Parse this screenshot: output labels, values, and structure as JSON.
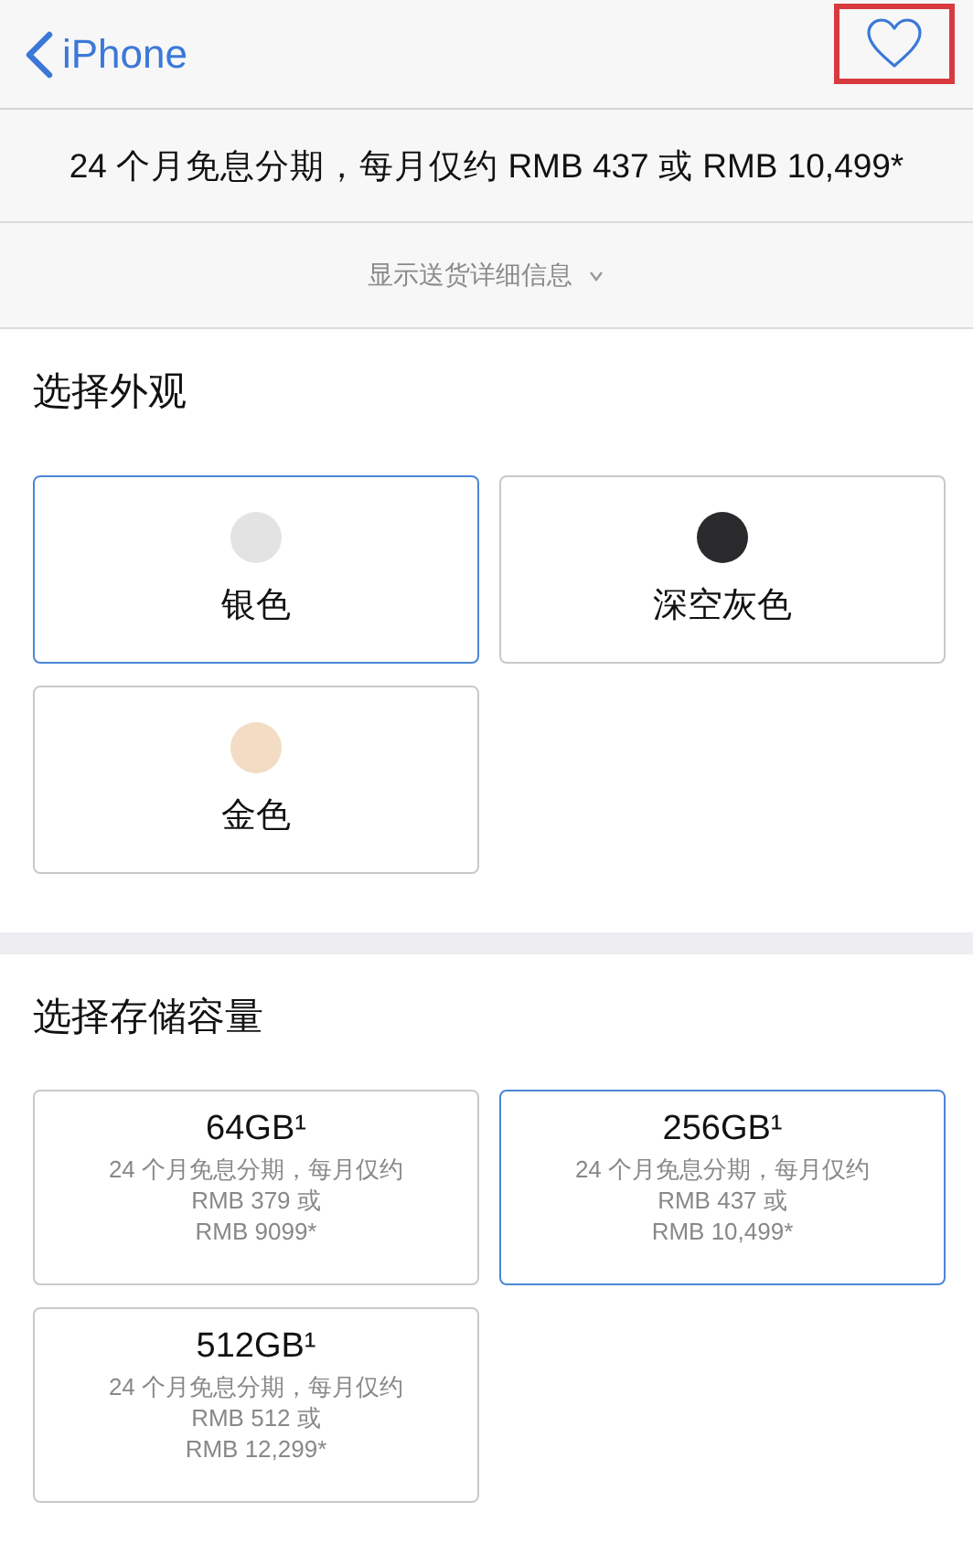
{
  "nav": {
    "back_label": "iPhone",
    "favorite": {
      "highlighted": true
    }
  },
  "promo": "24 个月免息分期，每月仅约 RMB 437 或 RMB 10,499*",
  "shipping_toggle": {
    "label": "显示送货详细信息",
    "expanded": false
  },
  "finish": {
    "heading": "选择外观",
    "options": [
      {
        "label": "银色",
        "color": "#e3e3e3",
        "selected": true
      },
      {
        "label": "深空灰色",
        "color": "#2a2a2c",
        "selected": false
      },
      {
        "label": "金色",
        "color": "#f2dcc4",
        "selected": false
      }
    ]
  },
  "storage": {
    "heading": "选择存储容量",
    "options": [
      {
        "capacity": "64GB¹",
        "lines": [
          "24 个月免息分期，每月仅约",
          "RMB 379 或",
          "RMB 9099*"
        ],
        "selected": false
      },
      {
        "capacity": "256GB¹",
        "lines": [
          "24 个月免息分期，每月仅约",
          "RMB 437 或",
          "RMB 10,499*"
        ],
        "selected": true
      },
      {
        "capacity": "512GB¹",
        "lines": [
          "24 个月免息分期，每月仅约",
          "RMB 512 或",
          "RMB 12,299*"
        ],
        "selected": false
      }
    ]
  }
}
